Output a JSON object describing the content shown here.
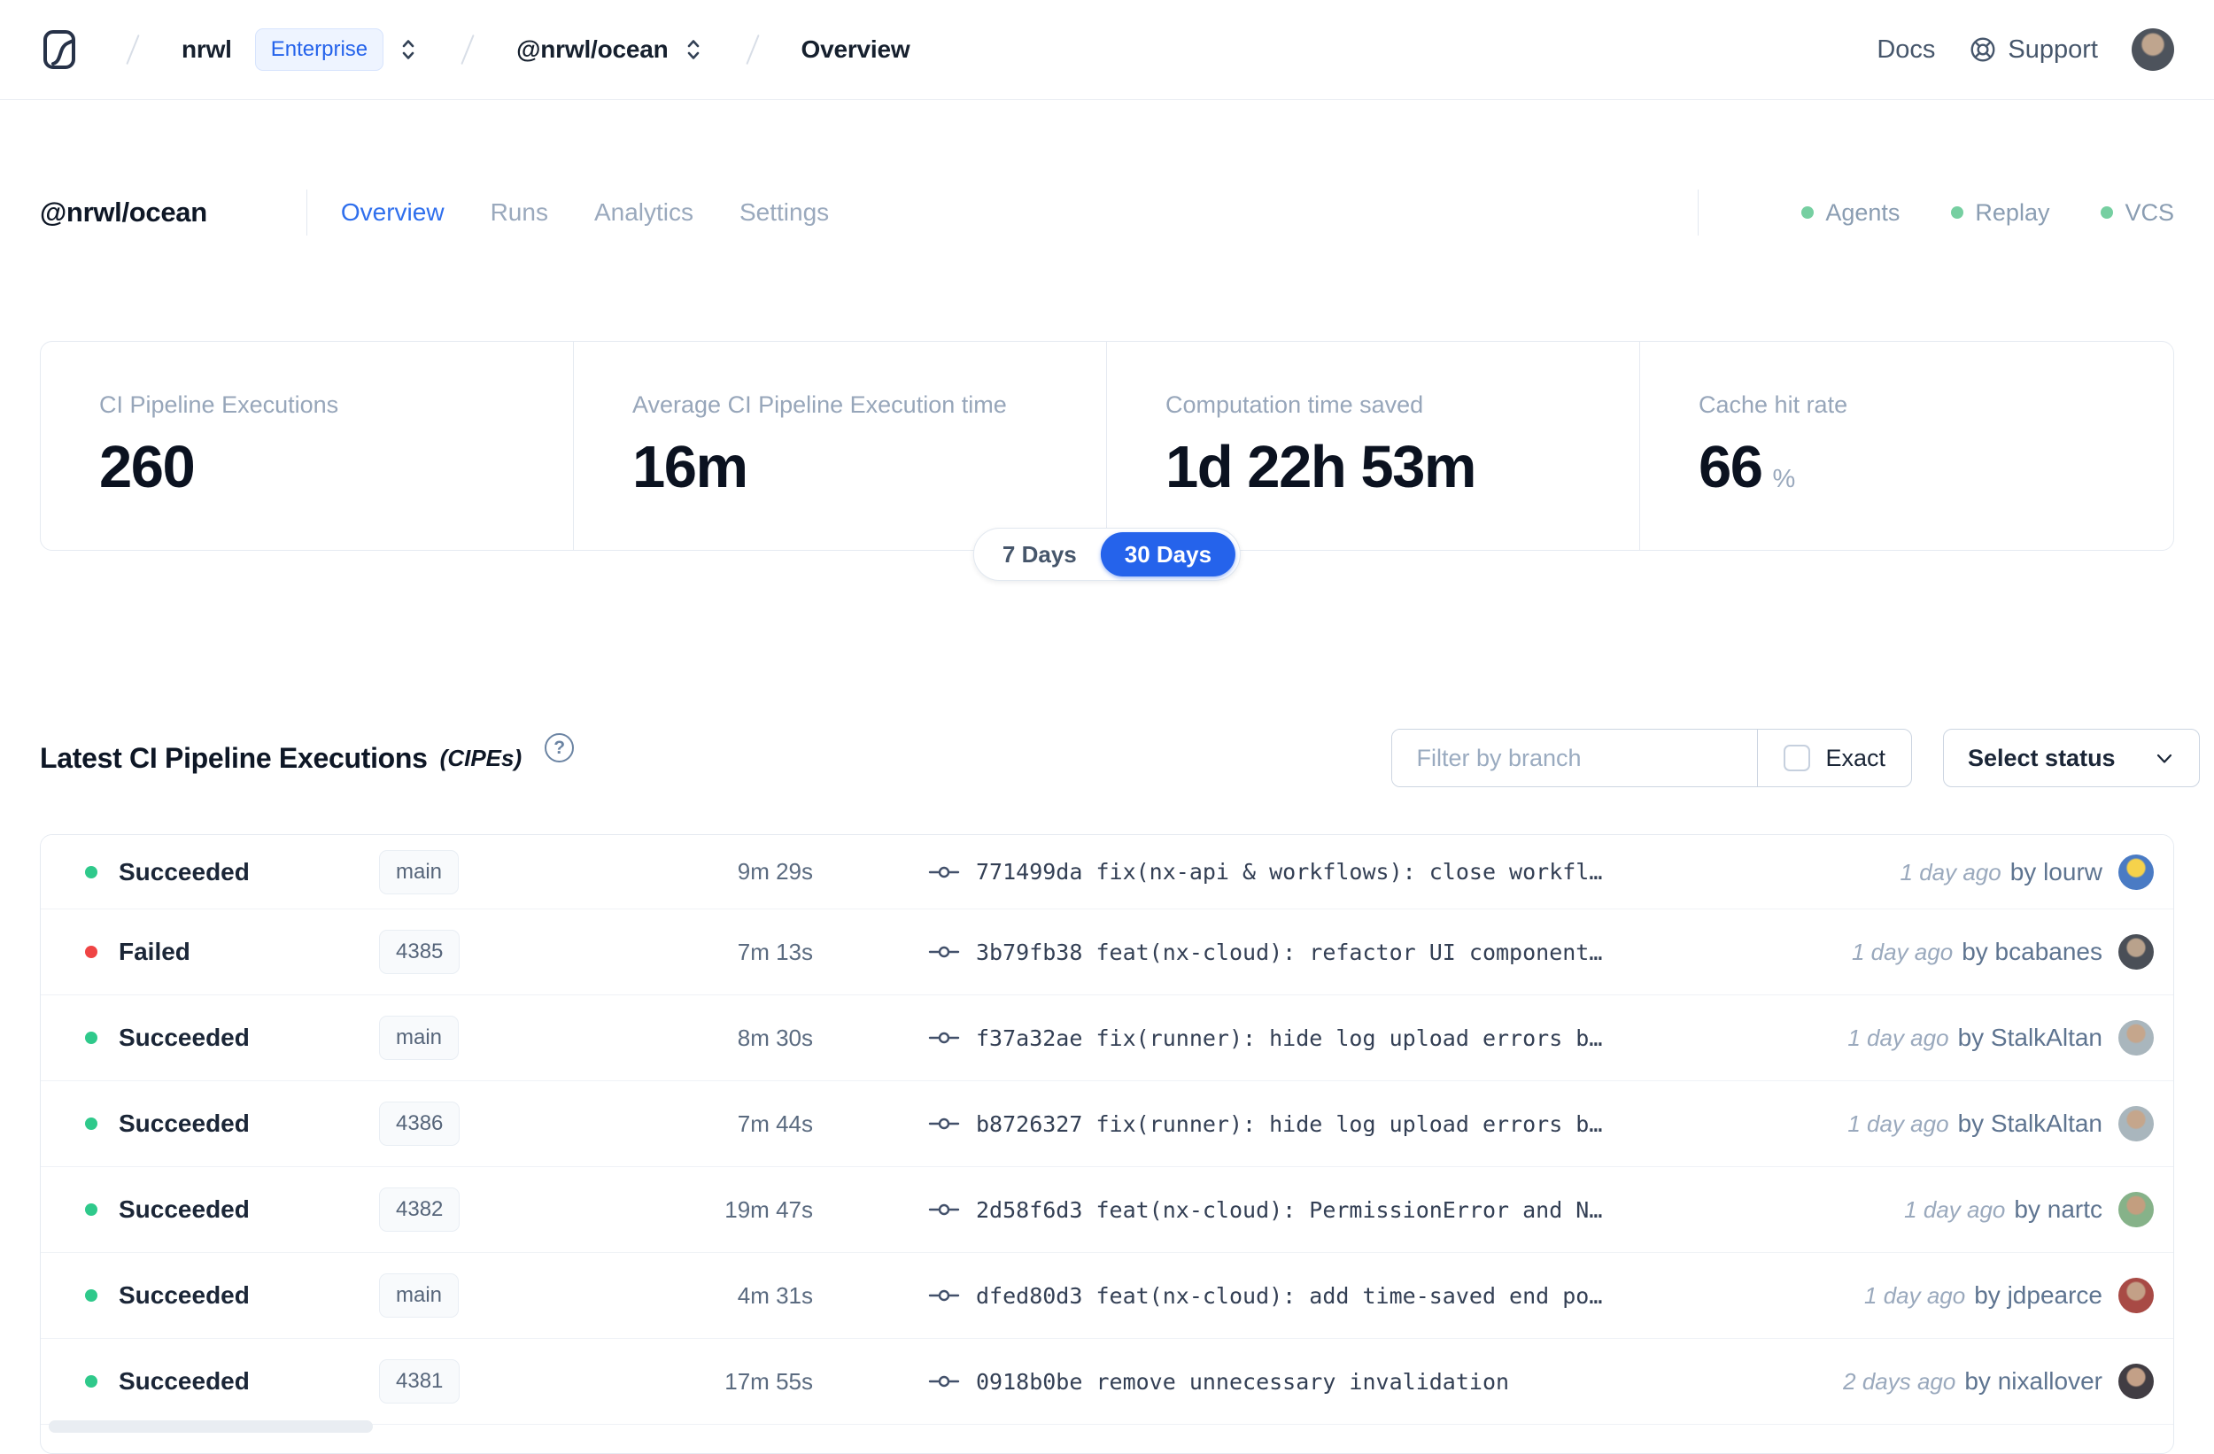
{
  "topbar": {
    "breadcrumb": {
      "org": "nrwl",
      "org_badge": "Enterprise",
      "workspace": "@nrwl/ocean",
      "page": "Overview"
    },
    "links": {
      "docs": "Docs",
      "support": "Support"
    },
    "avatar_colors": [
      "#bfa58e",
      "#4d535c"
    ]
  },
  "header": {
    "title": "@nrwl/ocean",
    "tabs": [
      {
        "label": "Overview",
        "active": true
      },
      {
        "label": "Runs",
        "active": false
      },
      {
        "label": "Analytics",
        "active": false
      },
      {
        "label": "Settings",
        "active": false
      }
    ],
    "statuses": [
      {
        "label": "Agents",
        "dot_color": "#76cfa1"
      },
      {
        "label": "Replay",
        "dot_color": "#76cfa1"
      },
      {
        "label": "VCS",
        "dot_color": "#76cfa1"
      }
    ]
  },
  "stats": {
    "cards": [
      {
        "label": "CI Pipeline Executions",
        "value": "260",
        "suffix": ""
      },
      {
        "label": "Average CI Pipeline Execution time",
        "value": "16m",
        "suffix": ""
      },
      {
        "label": "Computation time saved",
        "value": "1d 22h 53m",
        "suffix": ""
      },
      {
        "label": "Cache hit rate",
        "value": "66",
        "suffix": "%"
      }
    ],
    "range_toggle": {
      "options": [
        "7 Days",
        "30 Days"
      ],
      "selected": "30 Days",
      "accent": "#2563eb"
    }
  },
  "section": {
    "title": "Latest CI Pipeline Executions",
    "subtitle": "(CIPEs)",
    "help_glyph": "?",
    "filter_placeholder": "Filter by branch",
    "exact_label": "Exact",
    "exact_checked": false,
    "status_select_label": "Select status"
  },
  "table": {
    "rows": [
      {
        "status": "Succeeded",
        "status_color": "#2fc98b",
        "branch": "main",
        "duration": "9m 29s",
        "commit": "771499da fix(nx-api & workflows): close workfl…",
        "time": "1 day ago",
        "author": "by lourw",
        "avatar": [
          "#f6d24b",
          "#4a7bc4"
        ]
      },
      {
        "status": "Failed",
        "status_color": "#ef4444",
        "branch": "4385",
        "duration": "7m 13s",
        "commit": "3b79fb38 feat(nx-cloud): refactor UI component…",
        "time": "1 day ago",
        "author": "by bcabanes",
        "avatar": [
          "#b9a28c",
          "#4a4f57"
        ]
      },
      {
        "status": "Succeeded",
        "status_color": "#2fc98b",
        "branch": "main",
        "duration": "8m 30s",
        "commit": "f37a32ae fix(runner): hide log upload errors b…",
        "time": "1 day ago",
        "author": "by StalkAltan",
        "avatar": [
          "#c5a68c",
          "#a9b6bd"
        ]
      },
      {
        "status": "Succeeded",
        "status_color": "#2fc98b",
        "branch": "4386",
        "duration": "7m 44s",
        "commit": "b8726327 fix(runner): hide log upload errors b…",
        "time": "1 day ago",
        "author": "by StalkAltan",
        "avatar": [
          "#c5a68c",
          "#a9b6bd"
        ]
      },
      {
        "status": "Succeeded",
        "status_color": "#2fc98b",
        "branch": "4382",
        "duration": "19m 47s",
        "commit": "2d58f6d3 feat(nx-cloud): PermissionError and N…",
        "time": "1 day ago",
        "author": "by nartc",
        "avatar": [
          "#c39e7f",
          "#86b289"
        ]
      },
      {
        "status": "Succeeded",
        "status_color": "#2fc98b",
        "branch": "main",
        "duration": "4m 31s",
        "commit": "dfed80d3 feat(nx-cloud): add time-saved end po…",
        "time": "1 day ago",
        "author": "by jdpearce",
        "avatar": [
          "#c3a087",
          "#a84a45"
        ]
      },
      {
        "status": "Succeeded",
        "status_color": "#2fc98b",
        "branch": "4381",
        "duration": "17m 55s",
        "commit": "0918b0be remove unnecessary invalidation",
        "time": "2 days ago",
        "author": "by nixallover",
        "avatar": [
          "#c3a087",
          "#413d43"
        ]
      }
    ]
  }
}
